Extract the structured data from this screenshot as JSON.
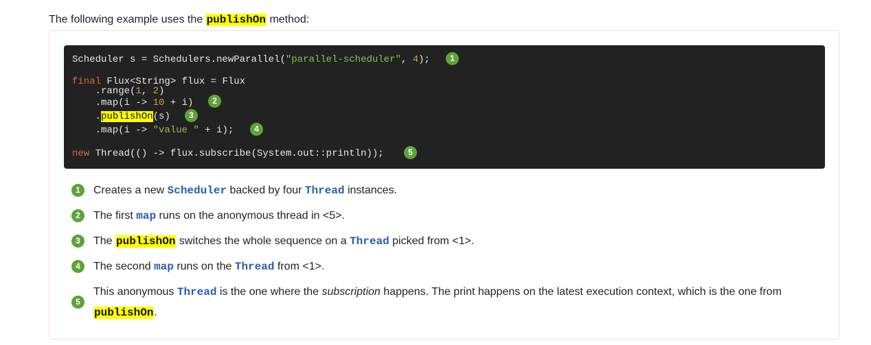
{
  "intro": {
    "before": "The following example uses the",
    "method": "publishOn",
    "after": "method:"
  },
  "code": {
    "l1_a": "Scheduler s = Schedulers.newParallel(",
    "l1_str": "\"parallel-scheduler\"",
    "l1_b": ", ",
    "l1_num": "4",
    "l1_c": ");",
    "l2_kw": "final",
    "l2_a": " Flux<String> flux = Flux",
    "l3_a": "    .range(",
    "l3_n1": "1",
    "l3_b": ", ",
    "l3_n2": "2",
    "l3_c": ")",
    "l4_a": "    .map(i -> ",
    "l4_num": "10",
    "l4_b": " + i)",
    "l5_a": "    .",
    "l5_hl": "publishOn",
    "l5_b": "(s)",
    "l6_a": "    .map(i -> ",
    "l6_str": "\"value \"",
    "l6_b": " + i);",
    "l7_kw": "new",
    "l7_a": " Thread(() -> flux.subscribe(System.out::println));"
  },
  "badges": [
    "1",
    "2",
    "3",
    "4",
    "5"
  ],
  "callouts": {
    "c1": {
      "a": "Creates a new",
      "code1": "Scheduler",
      "b": "backed by four",
      "code2": "Thread",
      "c": "instances."
    },
    "c2": {
      "a": "The first",
      "code1": "map",
      "b": "runs on the anonymous thread in <5>."
    },
    "c3": {
      "a": "The",
      "hl": "publishOn",
      "b": "switches the whole sequence on a",
      "code1": "Thread",
      "c": "picked from <1>."
    },
    "c4": {
      "a": "The second",
      "code1": "map",
      "b": "runs on the",
      "code2": "Thread",
      "c": "from <1>."
    },
    "c5": {
      "a": "This anonymous",
      "code1": "Thread",
      "b": "is the one where the",
      "em": "subscription",
      "c": "happens. The print happens on the latest execution context, which is the one from",
      "hl": "publishOn",
      "d": "."
    }
  },
  "colors": {
    "badge": "#5ea33b",
    "code_bg": "#222222",
    "string": "#8fbf4f",
    "number": "#c8a04a",
    "keyword": "#d96a3b",
    "highlight": "#ffff00",
    "inline_code": "#2a5bb3"
  }
}
